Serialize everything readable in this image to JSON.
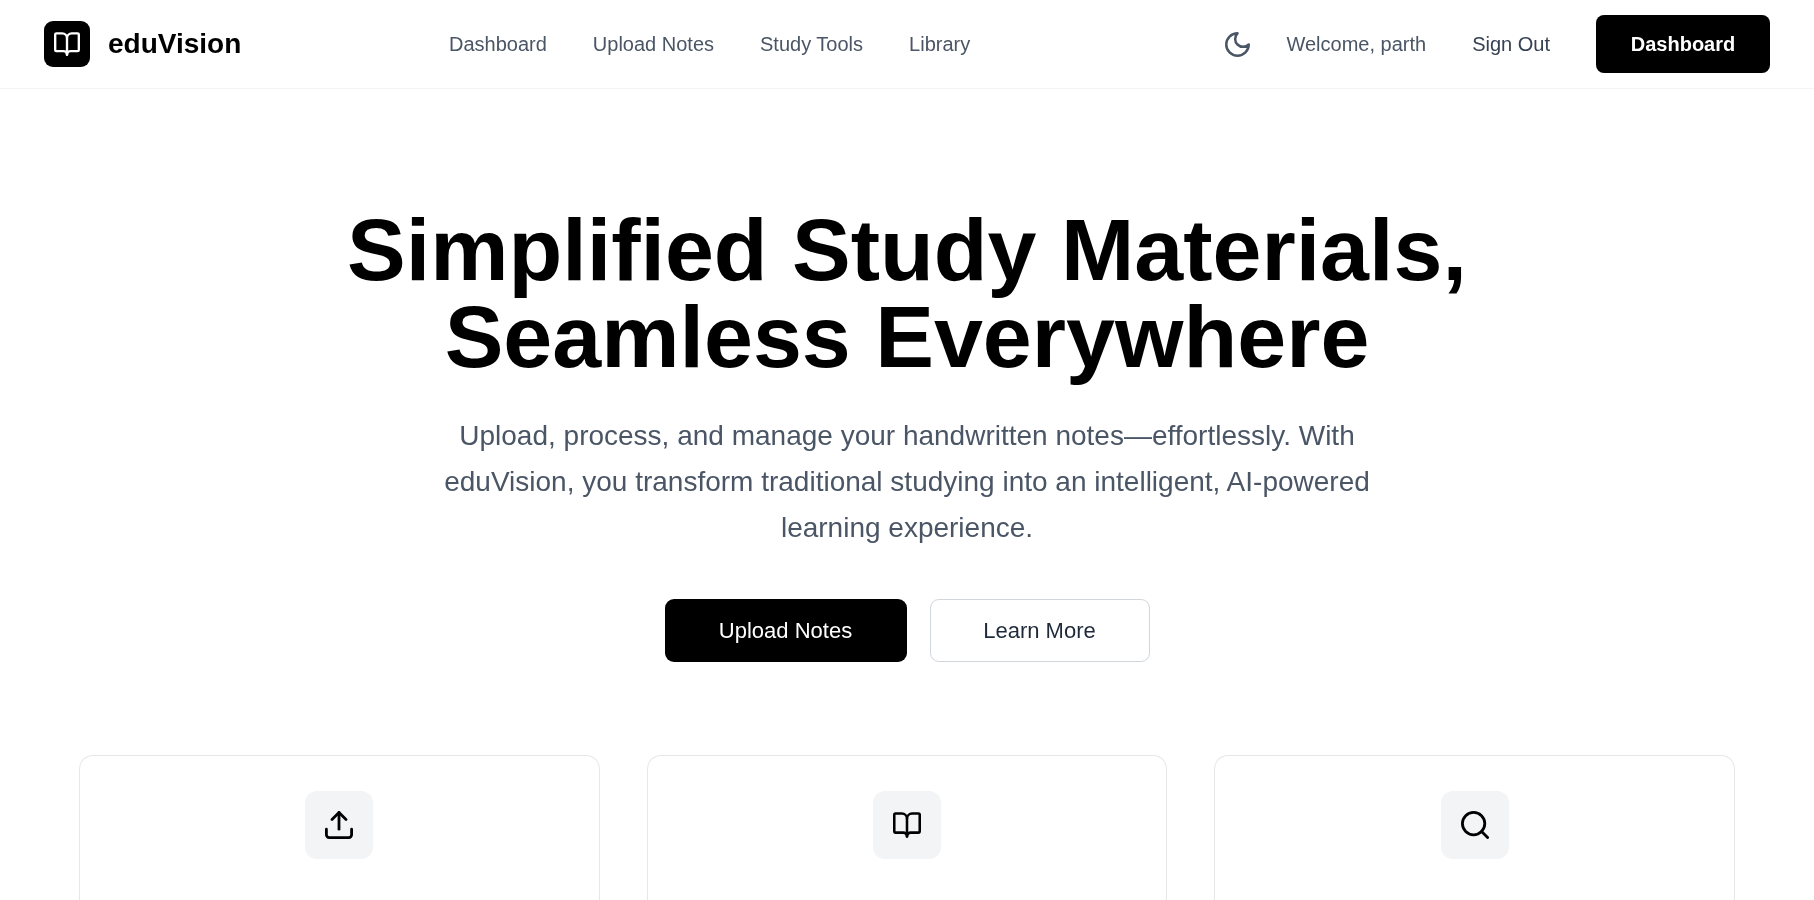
{
  "header": {
    "brand": "eduVision",
    "nav": [
      "Dashboard",
      "Upload Notes",
      "Study Tools",
      "Library"
    ],
    "welcome": "Welcome, parth",
    "sign_out": "Sign Out",
    "dashboard_button": "Dashboard"
  },
  "hero": {
    "title": "Simplified Study Materials, Seamless Everywhere",
    "description": "Upload, process, and manage your handwritten notes—effortlessly. With eduVision, you transform traditional studying into an intelligent, AI-powered learning experience.",
    "buttons": [
      {
        "label": "Upload Notes",
        "kind": "primary"
      },
      {
        "label": "Learn More",
        "kind": "secondary"
      }
    ]
  },
  "features": [
    {
      "kind": "upload"
    },
    {
      "kind": "book"
    },
    {
      "kind": "search"
    }
  ]
}
